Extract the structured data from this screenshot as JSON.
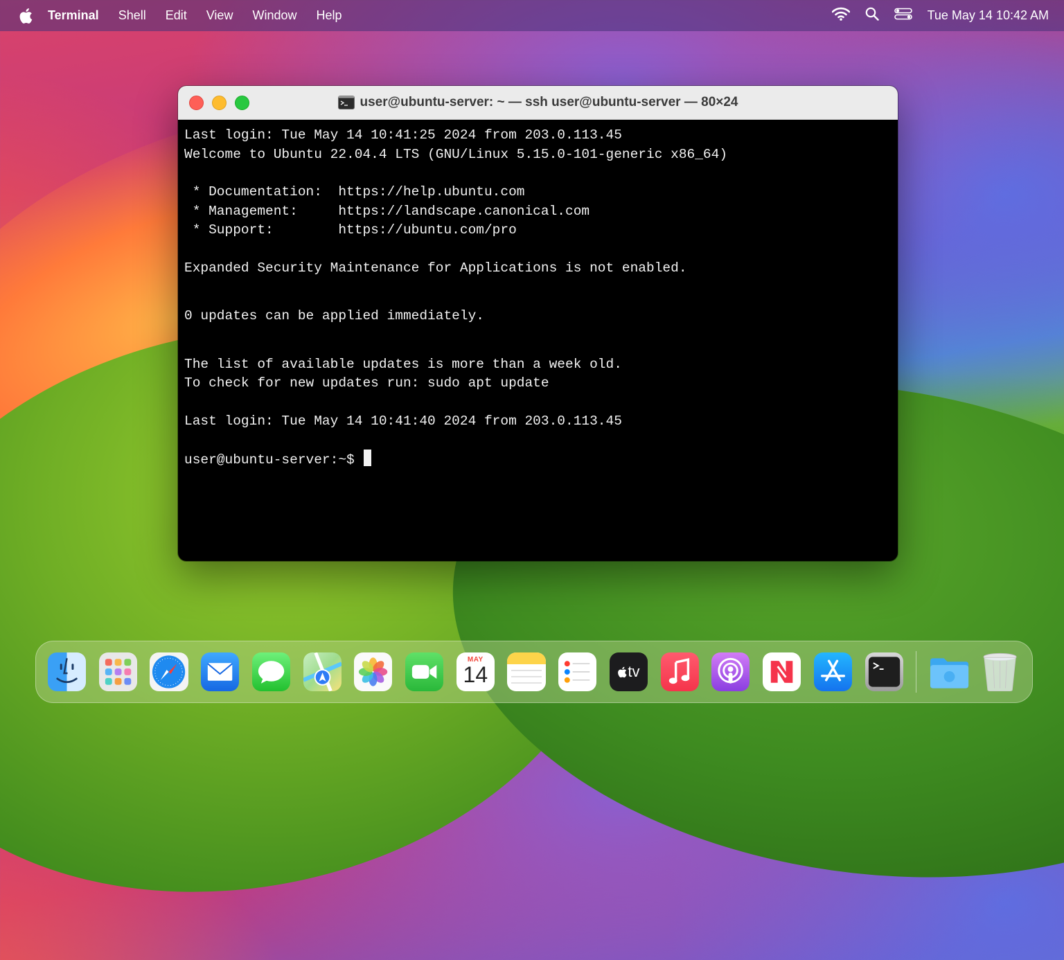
{
  "menubar": {
    "items": [
      "Terminal",
      "Shell",
      "Edit",
      "View",
      "Window",
      "Help"
    ],
    "clock": "Tue May 14  10:42 AM"
  },
  "window": {
    "title": "user@ubuntu-server: ~ — ssh user@ubuntu-server — 80×24"
  },
  "terminal": {
    "lines": [
      "Last login: Tue May 14 10:41:25 2024 from 203.0.113.45",
      "Welcome to Ubuntu 22.04.4 LTS (GNU/Linux 5.15.0-101-generic x86_64)",
      " * Documentation:  https://help.ubuntu.com",
      " * Management:     https://landscape.canonical.com",
      " * Support:        https://ubuntu.com/pro",
      "Expanded Security Maintenance for Applications is not enabled.",
      "0 updates can be applied immediately.",
      "The list of available updates is more than a week old.",
      "To check for new updates run: sudo apt update",
      "Last login: Tue May 14 10:41:40 2024 from 203.0.113.45"
    ],
    "prompt": "user@ubuntu-server:~$ "
  },
  "dock": {
    "calendar_month": "MAY",
    "calendar_day": "14",
    "tv_label": "tv"
  },
  "colors": {
    "close": "#fe5f57",
    "minimize": "#febc2e",
    "zoom": "#28c840",
    "terminal_bg": "#000000",
    "terminal_fg": "#f2f2f2"
  }
}
